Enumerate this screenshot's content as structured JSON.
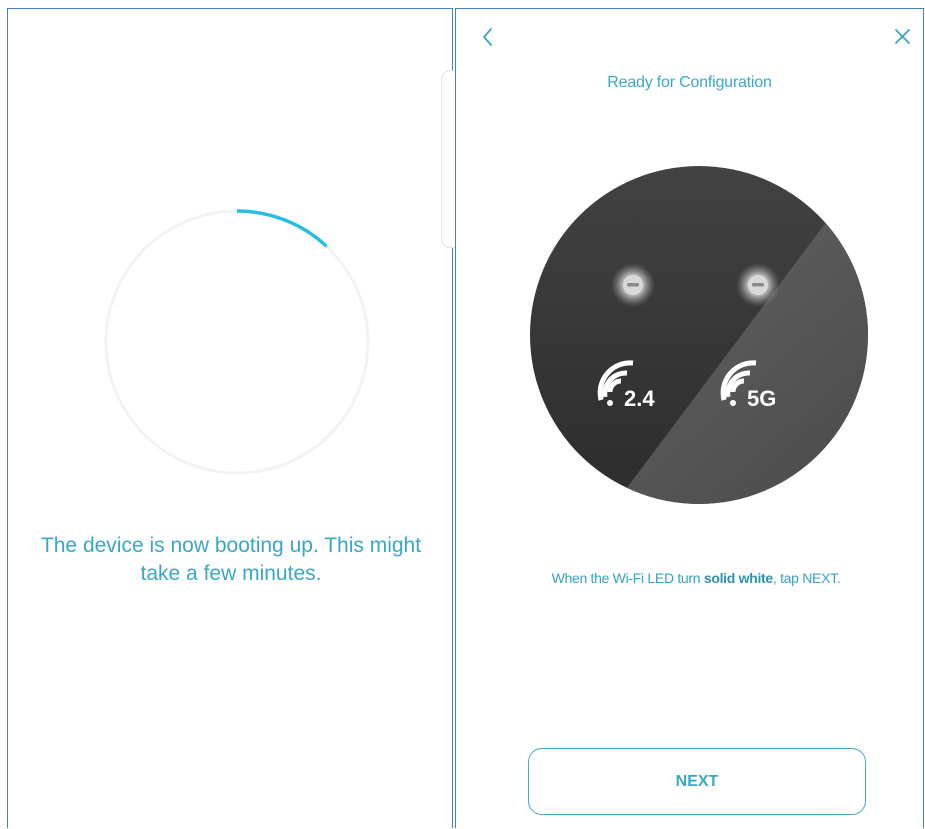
{
  "boot_screen": {
    "message": "The device is now booting up. This might take a few minutes.",
    "spinner_color": "#26bfe0"
  },
  "config_screen": {
    "back_icon": "chevron-left-icon",
    "close_icon": "close-icon",
    "title": "Ready for Configuration",
    "device": {
      "band_24_label": "2.4",
      "band_5_label": "5G"
    },
    "instruction": {
      "before": "When the Wi-Fi LED turn ",
      "emphasis": "solid white",
      "after": ", tap NEXT."
    },
    "next_label": "NEXT"
  },
  "colors": {
    "accent": "#3aa7c7",
    "frame_border": "#3f85c9",
    "device_body": "#4a4a4a"
  }
}
